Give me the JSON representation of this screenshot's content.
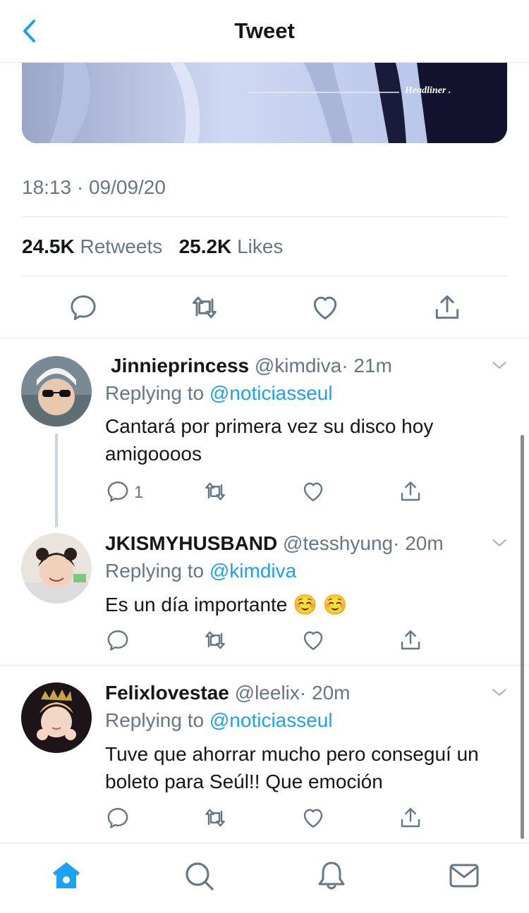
{
  "header": {
    "title": "Tweet"
  },
  "media": {
    "watermark": "Headliner ."
  },
  "tweet": {
    "timestamp": "18:13 · 09/09/20",
    "retweets_count": "24.5K",
    "retweets_label": "Retweets",
    "likes_count": "25.2K",
    "likes_label": "Likes"
  },
  "replies": [
    {
      "name": "Jinnieprincess",
      "handle": "@kimdiva",
      "time": "· 21m",
      "replying_prefix": "Replying to",
      "replying_to": "@noticiasseul",
      "text": "Cantará por primera vez su disco hoy amigoooos",
      "reply_count": "1"
    },
    {
      "name": "JKISMYHUSBAND",
      "handle": "@tesshyung",
      "time": "· 20m",
      "replying_prefix": "Replying to",
      "replying_to": "@kimdiva",
      "text": "Es un día importante ☺️ ☺️"
    },
    {
      "name": "Felixlovestae",
      "handle": "@leelix",
      "time": "· 20m",
      "replying_prefix": "Replying to",
      "replying_to": "@noticiasseul",
      "text": "Tuve que ahorrar mucho pero conseguí un boleto para Seúl!! Que emoción"
    }
  ],
  "colors": {
    "accent": "#1da1f2",
    "secondary_text": "#657786",
    "divider": "#e1e8ed"
  },
  "icons": [
    "back-chevron-icon",
    "reply-icon",
    "retweet-icon",
    "like-icon",
    "share-icon",
    "chevron-down-icon",
    "home-icon",
    "search-icon",
    "notifications-icon",
    "messages-icon"
  ]
}
